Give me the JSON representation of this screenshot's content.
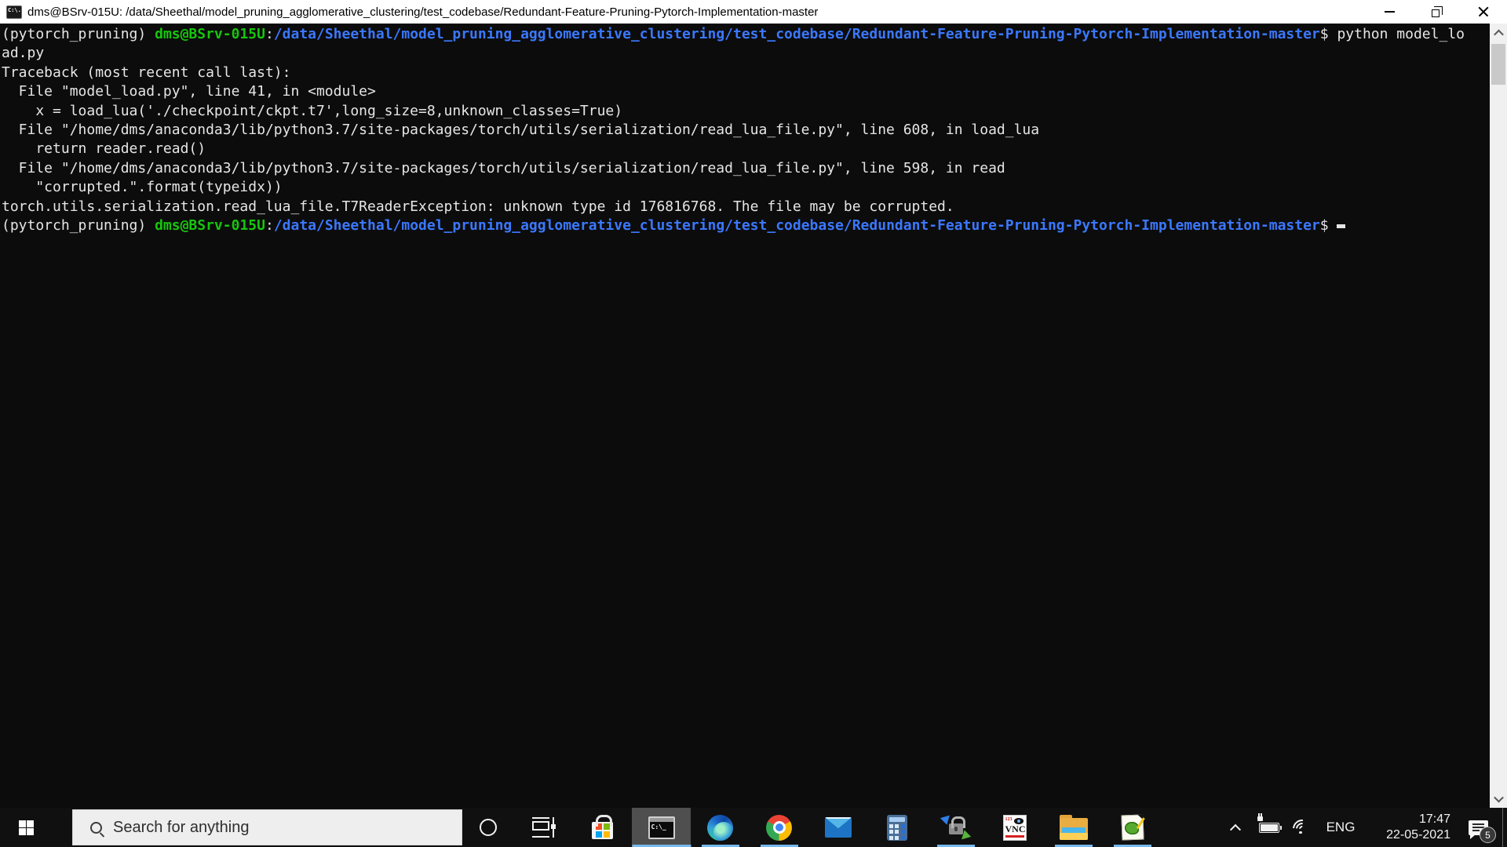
{
  "window": {
    "title": "dms@BSrv-015U: /data/Sheethal/model_pruning_agglomerative_clustering/test_codebase/Redundant-Feature-Pruning-Pytorch-Implementation-master"
  },
  "terminal": {
    "colors": {
      "background": "#0c0c0c",
      "foreground": "#e6e6e6",
      "prompt_user_green": "#16c60c",
      "path_blue": "#3b78ff"
    },
    "lines": [
      {
        "segments": [
          {
            "c": "w",
            "t": "(pytorch_pruning) "
          },
          {
            "c": "g",
            "t": "dms@BSrv-015U"
          },
          {
            "c": "w",
            "t": ":"
          },
          {
            "c": "b",
            "t": "/data/Sheethal/model_pruning_agglomerative_clustering/test_codebase/Redundant-Feature-Pruning-Pytorch-Implementation-master"
          },
          {
            "c": "w",
            "t": "$ python model_lo"
          }
        ]
      },
      {
        "segments": [
          {
            "c": "w",
            "t": "ad.py"
          }
        ]
      },
      {
        "segments": [
          {
            "c": "w",
            "t": "Traceback (most recent call last):"
          }
        ]
      },
      {
        "segments": [
          {
            "c": "w",
            "t": "  File \"model_load.py\", line 41, in <module>"
          }
        ]
      },
      {
        "segments": [
          {
            "c": "w",
            "t": "    x = load_lua('./checkpoint/ckpt.t7',long_size=8,unknown_classes=True)"
          }
        ]
      },
      {
        "segments": [
          {
            "c": "w",
            "t": "  File \"/home/dms/anaconda3/lib/python3.7/site-packages/torch/utils/serialization/read_lua_file.py\", line 608, in load_lua"
          }
        ]
      },
      {
        "segments": [
          {
            "c": "w",
            "t": "    return reader.read()"
          }
        ]
      },
      {
        "segments": [
          {
            "c": "w",
            "t": "  File \"/home/dms/anaconda3/lib/python3.7/site-packages/torch/utils/serialization/read_lua_file.py\", line 598, in read"
          }
        ]
      },
      {
        "segments": [
          {
            "c": "w",
            "t": "    \"corrupted.\".format(typeidx))"
          }
        ]
      },
      {
        "segments": [
          {
            "c": "w",
            "t": "torch.utils.serialization.read_lua_file.T7ReaderException: unknown type id 176816768. The file may be corrupted."
          }
        ]
      },
      {
        "segments": [
          {
            "c": "w",
            "t": "(pytorch_pruning) "
          },
          {
            "c": "g",
            "t": "dms@BSrv-015U"
          },
          {
            "c": "w",
            "t": ":"
          },
          {
            "c": "b",
            "t": "/data/Sheethal/model_pruning_agglomerative_clustering/test_codebase/Redundant-Feature-Pruning-Pytorch-Implementation-master"
          },
          {
            "c": "w",
            "t": "$ "
          }
        ],
        "cursor": true
      }
    ]
  },
  "taskbar": {
    "search_placeholder": "Search for anything",
    "accent_underline_color": "#76b9ed",
    "icons": [
      {
        "id": "task-view",
        "running": false,
        "active": false
      },
      {
        "id": "microsoft-store",
        "running": false,
        "active": false
      },
      {
        "id": "terminal",
        "running": true,
        "active": true
      },
      {
        "id": "edge",
        "running": true,
        "active": false
      },
      {
        "id": "chrome",
        "running": true,
        "active": false
      },
      {
        "id": "mail",
        "running": false,
        "active": false
      },
      {
        "id": "calculator",
        "running": false,
        "active": false
      },
      {
        "id": "file-transfer-lock",
        "running": true,
        "active": false
      },
      {
        "id": "vnc-viewer",
        "running": false,
        "active": false
      },
      {
        "id": "file-explorer",
        "running": true,
        "active": false
      },
      {
        "id": "notepad-plus-plus",
        "running": true,
        "active": false
      }
    ],
    "tray": {
      "language": "ENG",
      "time": "17:47",
      "date": "22-05-2021",
      "notification_count": "5"
    }
  }
}
